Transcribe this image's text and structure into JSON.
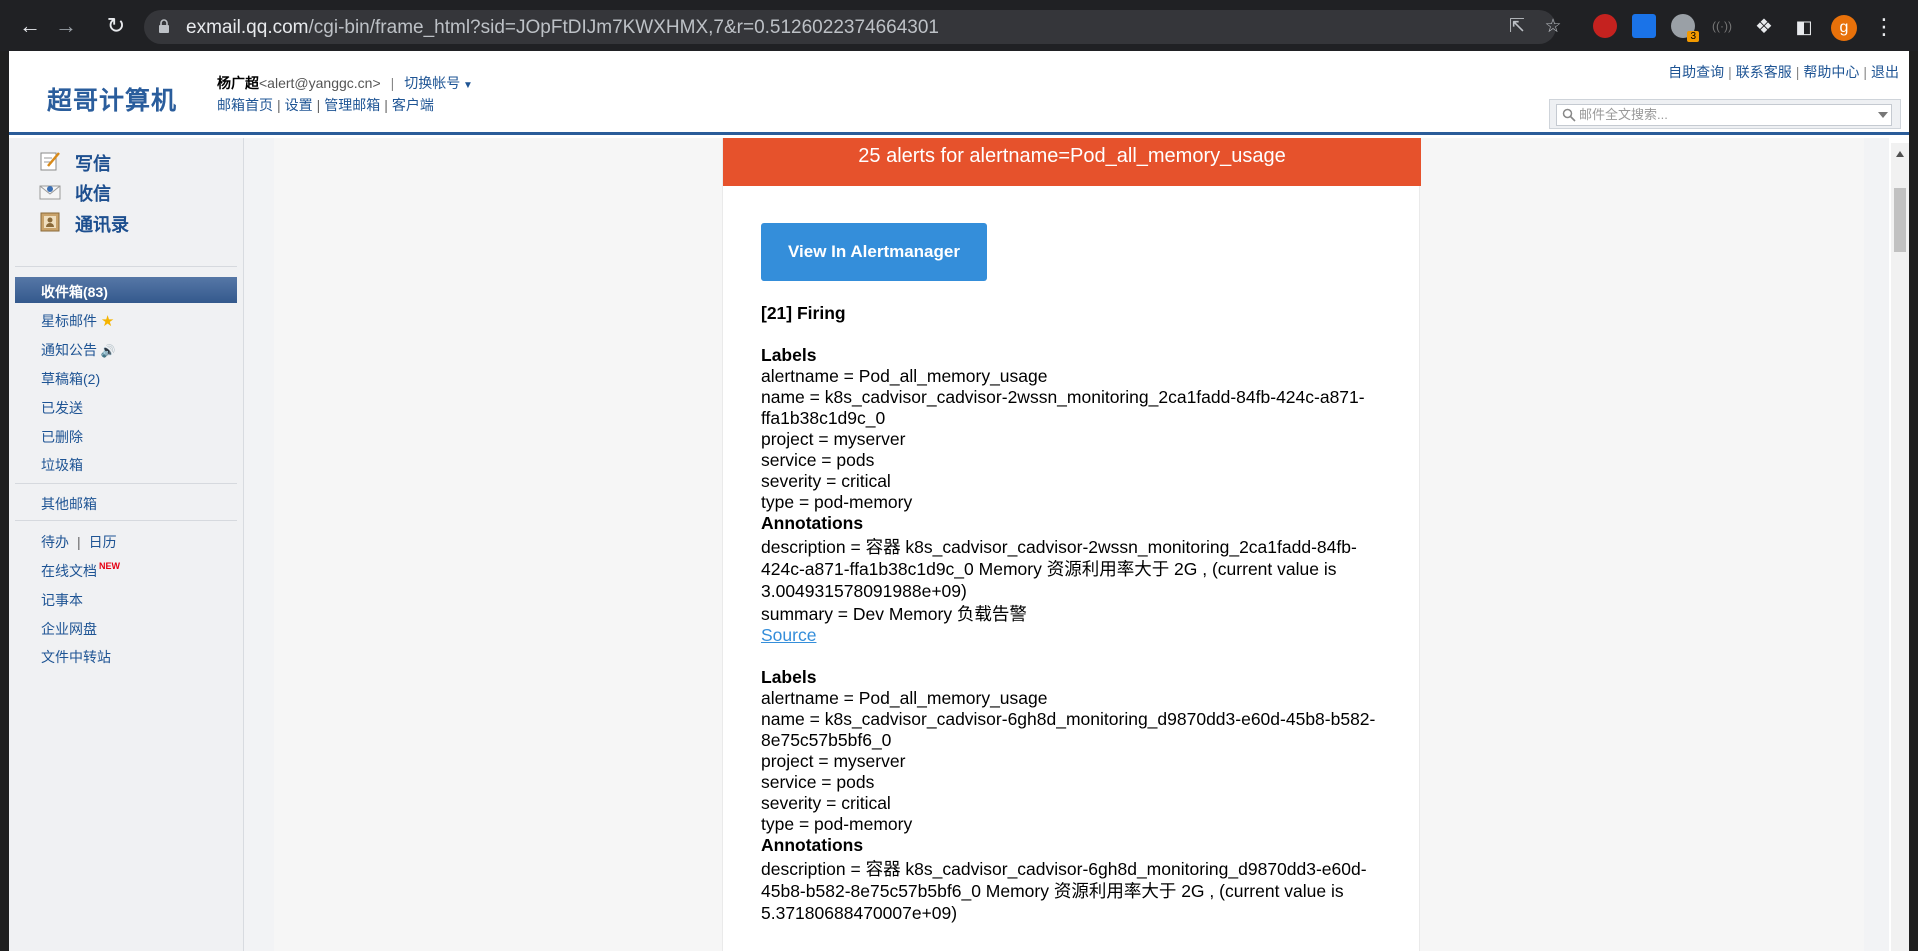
{
  "browser": {
    "url_host": "exmail.qq.com",
    "url_path": "/cgi-bin/frame_html?sid=JOpFtDIJm7KWXHMX,7&r=0.5126022374664301",
    "profile_initial": "g",
    "extension_badge": "3"
  },
  "header": {
    "logo": "超哥计算机",
    "user_name": "杨广超",
    "user_email": "<alert@yanggc.cn>",
    "separator": "|",
    "switch_account": "切换帐号",
    "user_links": [
      "邮箱首页",
      "设置",
      "管理邮箱",
      "客户端"
    ],
    "top_links": [
      "自助查询",
      "联系客服",
      "帮助中心",
      "退出"
    ],
    "search_placeholder": "邮件全文搜索..."
  },
  "sidebar": {
    "big_items": [
      "写信",
      "收信",
      "通讯录"
    ],
    "inbox": "收件箱(83)",
    "folders": [
      "星标邮件",
      "通知公告",
      "草稿箱(2)",
      "已发送",
      "已删除",
      "垃圾箱"
    ],
    "other_mailbox": "其他邮箱",
    "todo": "待办",
    "calendar": "日历",
    "tools": [
      "在线文档",
      "记事本",
      "企业网盘",
      "文件中转站"
    ],
    "new_badge": "NEW"
  },
  "mail": {
    "banner": "25 alerts for alertname=Pod_all_memory_usage",
    "button": "View In Alertmanager",
    "firing_title": "[21] Firing",
    "labels_heading": "Labels",
    "annotations_heading": "Annotations",
    "source_link": "Source",
    "alerts": [
      {
        "alertname": "alertname = Pod_all_memory_usage",
        "name": "name = k8s_cadvisor_cadvisor-2wssn_monitoring_2ca1fadd-84fb-424c-a871-ffa1b38c1d9c_0",
        "project": "project = myserver",
        "service": "service = pods",
        "severity": "severity = critical",
        "type": "type = pod-memory",
        "description": "description = 容器 k8s_cadvisor_cadvisor-2wssn_monitoring_2ca1fadd-84fb-424c-a871-ffa1b38c1d9c_0 Memory 资源利用率大于 2G , (current value is 3.004931578091988e+09)",
        "summary": "summary = Dev Memory 负载告警"
      },
      {
        "alertname": "alertname = Pod_all_memory_usage",
        "name": "name = k8s_cadvisor_cadvisor-6gh8d_monitoring_d9870dd3-e60d-45b8-b582-8e75c57b5bf6_0",
        "project": "project = myserver",
        "service": "service = pods",
        "severity": "severity = critical",
        "type": "type = pod-memory",
        "description": "description = 容器 k8s_cadvisor_cadvisor-6gh8d_monitoring_d9870dd3-e60d-45b8-b582-8e75c57b5bf6_0 Memory 资源利用率大于 2G , (current value is 5.37180688470007e+09)"
      }
    ]
  }
}
